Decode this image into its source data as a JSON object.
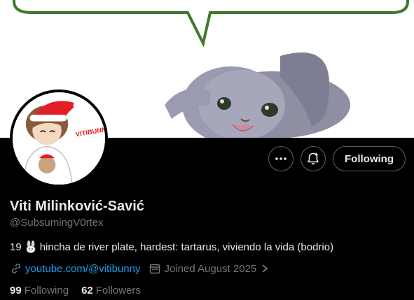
{
  "profile": {
    "display_name": "Viti Milinković-Savić",
    "handle": "@SubsumingV0rtex",
    "bio": {
      "prefix": "19",
      "emoji": "rabbit-emoji",
      "text": "hincha de river plate, hardest: tartarus, viviendo la vida (bodrio)"
    },
    "website": "youtube.com/@vitibunny",
    "joined": "Joined August 2025"
  },
  "actions": {
    "more_icon": "more-icon",
    "notify_icon": "notification-bell-icon",
    "following_label": "Following"
  },
  "stats": {
    "following_count": "99",
    "following_label": "Following",
    "followers_count": "62",
    "followers_label": "Followers"
  },
  "avatar": {
    "shirt_text": "VITIBUNNY!"
  },
  "colors": {
    "background": "#000000",
    "link": "#1d9bf0",
    "muted": "#71767b",
    "text": "#e7e9ea",
    "border": "#536471"
  }
}
